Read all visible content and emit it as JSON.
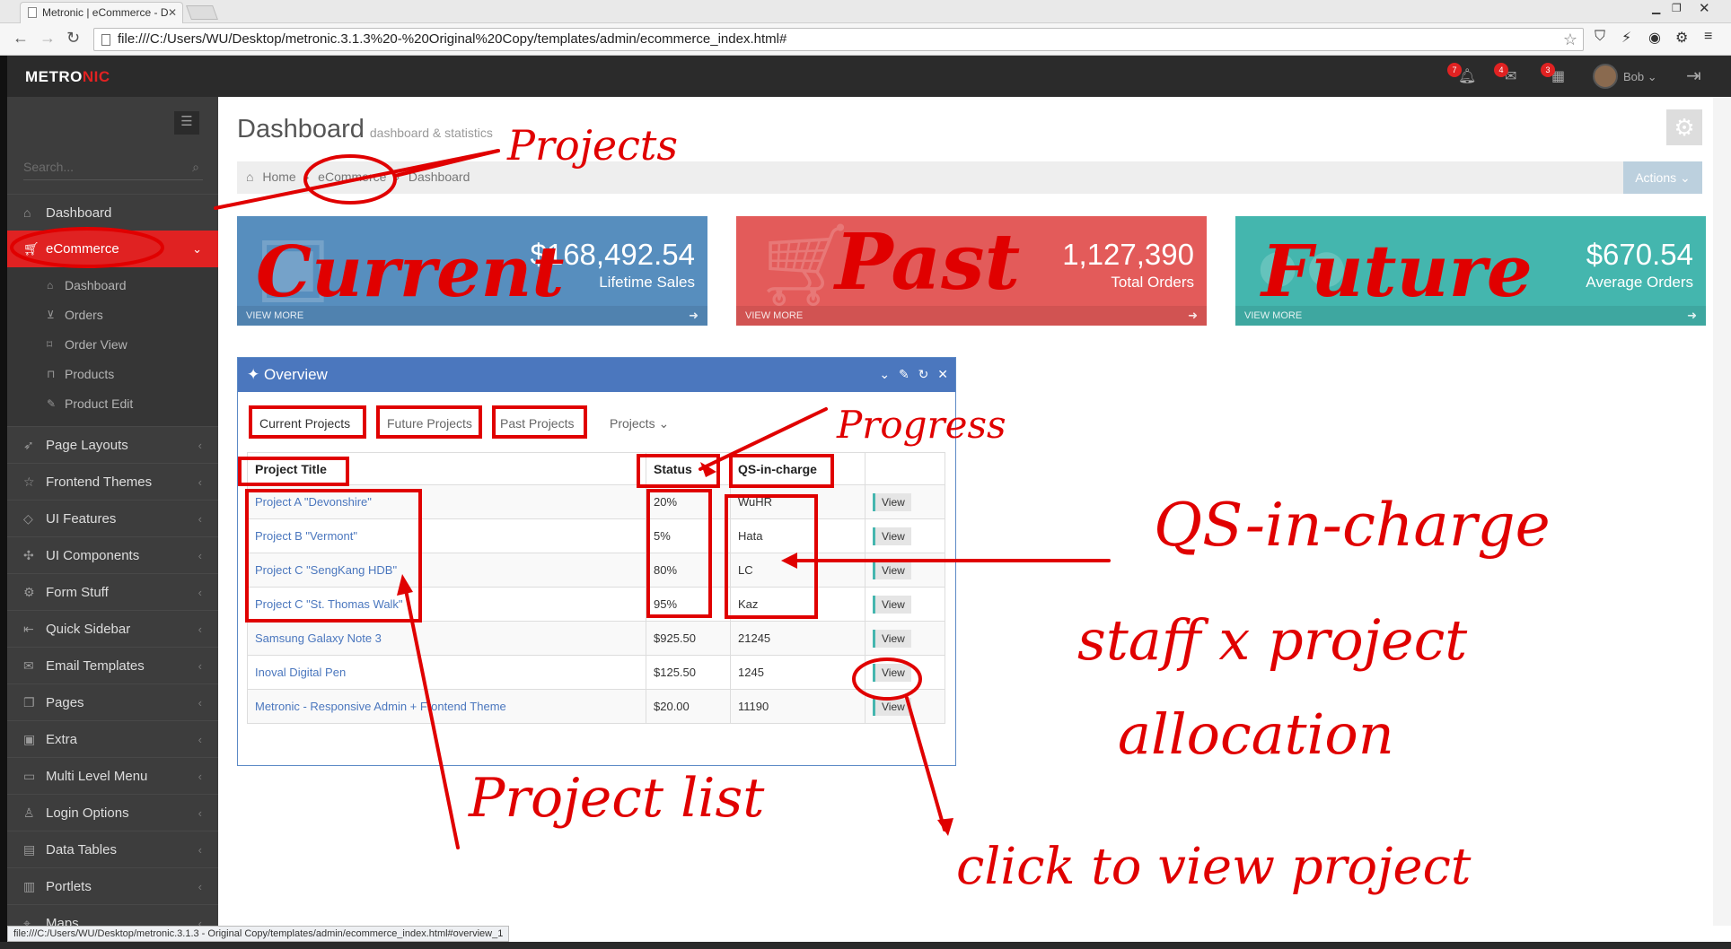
{
  "browser": {
    "tab_title": "Metronic | eCommerce - D",
    "tab_close": "✕",
    "url": "file:///C:/Users/WU/Desktop/metronic.3.1.3%20-%20Original%20Copy/templates/admin/ecommerce_index.html#",
    "status_url": "file:///C:/Users/WU/Desktop/metronic.3.1.3 - Original Copy/templates/admin/ecommerce_index.html#overview_1"
  },
  "header": {
    "logo_main": "METRO",
    "logo_accent": "NIC",
    "badges": [
      "7",
      "4",
      "3"
    ],
    "username": "Bob"
  },
  "sidebar": {
    "search_placeholder": "Search...",
    "items": [
      {
        "label": "Dashboard",
        "icon": "home-icon"
      },
      {
        "label": "eCommerce",
        "icon": "cart-icon",
        "active": true,
        "sub": [
          {
            "label": "Dashboard",
            "icon": "home-icon"
          },
          {
            "label": "Orders",
            "icon": "basket-icon"
          },
          {
            "label": "Order View",
            "icon": "tag-icon"
          },
          {
            "label": "Products",
            "icon": "handbag-icon"
          },
          {
            "label": "Product Edit",
            "icon": "pencil-icon"
          }
        ]
      },
      {
        "label": "Page Layouts",
        "icon": "rocket-icon"
      },
      {
        "label": "Frontend Themes",
        "icon": "star-icon"
      },
      {
        "label": "UI Features",
        "icon": "diamond-icon"
      },
      {
        "label": "UI Components",
        "icon": "puzzle-icon"
      },
      {
        "label": "Form Stuff",
        "icon": "settings-icon"
      },
      {
        "label": "Quick Sidebar",
        "icon": "logout-icon"
      },
      {
        "label": "Email Templates",
        "icon": "envelope-icon"
      },
      {
        "label": "Pages",
        "icon": "docs-icon"
      },
      {
        "label": "Extra",
        "icon": "present-icon"
      },
      {
        "label": "Multi Level Menu",
        "icon": "folder-icon"
      },
      {
        "label": "Login Options",
        "icon": "user-icon"
      },
      {
        "label": "Data Tables",
        "icon": "briefcase-icon"
      },
      {
        "label": "Portlets",
        "icon": "wallet-icon"
      },
      {
        "label": "Maps",
        "icon": "pointer-icon"
      }
    ]
  },
  "page": {
    "title": "Dashboard",
    "subtitle": "dashboard & statistics",
    "breadcrumb": [
      "Home",
      "eCommerce",
      "Dashboard"
    ],
    "actions_label": "Actions"
  },
  "stats": [
    {
      "value": "$168,492.54",
      "label": "Lifetime Sales",
      "more": "VIEW MORE",
      "color": "#578ebe"
    },
    {
      "value": "1,127,390",
      "label": "Total Orders",
      "more": "VIEW MORE",
      "color": "#e35b5a"
    },
    {
      "value": "$670.54",
      "label": "Average Orders",
      "more": "VIEW MORE",
      "color": "#44b6ae"
    }
  ],
  "overview": {
    "title": "Overview",
    "tabs": [
      "Current Projects",
      "Future Projects",
      "Past Projects",
      "Projects"
    ],
    "columns": [
      "Project Title",
      "Status",
      "QS-in-charge",
      ""
    ],
    "rows": [
      {
        "title": "Project A \"Devonshire\"",
        "status": "20%",
        "qs": "WuHR",
        "action": "View"
      },
      {
        "title": "Project B \"Vermont\"",
        "status": "5%",
        "qs": "Hata",
        "action": "View"
      },
      {
        "title": "Project C \"SengKang HDB\"",
        "status": "80%",
        "qs": "LC",
        "action": "View"
      },
      {
        "title": "Project C \"St. Thomas Walk\"",
        "status": "95%",
        "qs": "Kaz",
        "action": "View"
      },
      {
        "title": "Samsung Galaxy Note 3",
        "status": "$925.50",
        "qs": "21245",
        "action": "View"
      },
      {
        "title": "Inoval Digital Pen",
        "status": "$125.50",
        "qs": "1245",
        "action": "View"
      },
      {
        "title": "Metronic - Responsive Admin + Frontend Theme",
        "status": "$20.00",
        "qs": "11190",
        "action": "View"
      }
    ]
  },
  "annotations": {
    "projects": "Projects",
    "current": "Current",
    "past": "Past",
    "future": "Future",
    "progress": "Progress",
    "qs_in_charge": "QS-in-charge",
    "staff_allocation_1": "staff x project",
    "staff_allocation_2": "allocation",
    "project_list": "Project list",
    "click_to_view": "click to view project",
    "ink_color": "#e00000"
  }
}
